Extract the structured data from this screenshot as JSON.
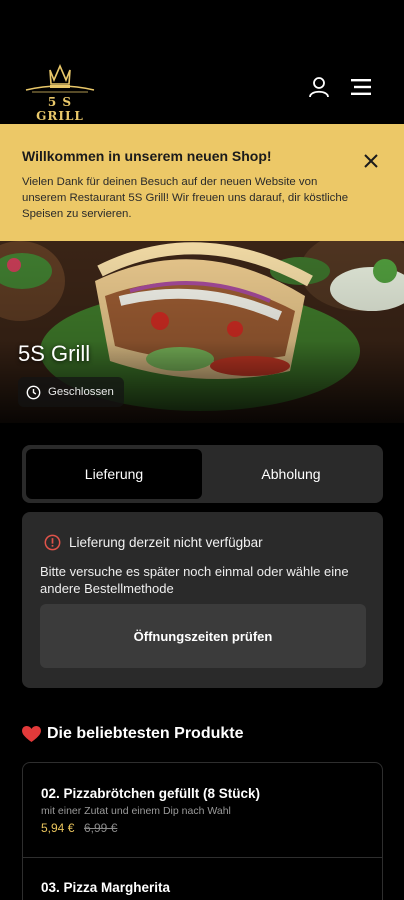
{
  "header": {
    "logo_text": "5 S GRILL",
    "icons": {
      "account": "user-icon",
      "menu": "hamburger-menu-icon"
    }
  },
  "banner": {
    "title": "Willkommen in unserem neuen Shop!",
    "text": "Vielen Dank für deinen Besuch auf der neuen Website von unserem Restaurant 5S Grill! Wir freuen uns darauf, dir köstliche Speisen zu servieren.",
    "close_icon": "close-icon",
    "background": "#ecc867"
  },
  "restaurant": {
    "name": "5S Grill",
    "status": "Geschlossen",
    "status_icon": "clock-icon"
  },
  "order_mode": {
    "options": [
      "Lieferung",
      "Abholung"
    ],
    "selected": "Lieferung"
  },
  "notice": {
    "title": "Lieferung derzeit nicht verfügbar",
    "title_icon": "alert-circle-icon",
    "text": "Bitte versuche es später noch einmal oder wähle eine andere Bestellmethode",
    "button_label": "Öffnungszeiten prüfen"
  },
  "popular": {
    "title": "Die beliebtesten Produkte",
    "title_icon": "heart-icon",
    "items": [
      {
        "name": "02. Pizzabrötchen gefüllt (8 Stück)",
        "description": "mit einer Zutat und einem Dip nach Wahl",
        "price": "5,94 €",
        "old_price": "6,99 €"
      },
      {
        "name": "03. Pizza Margherita"
      }
    ]
  },
  "colors": {
    "accent": "#e8c35c",
    "card": "#2a2a2a",
    "heart": "#e23a3a",
    "alert": "#e0534a"
  }
}
